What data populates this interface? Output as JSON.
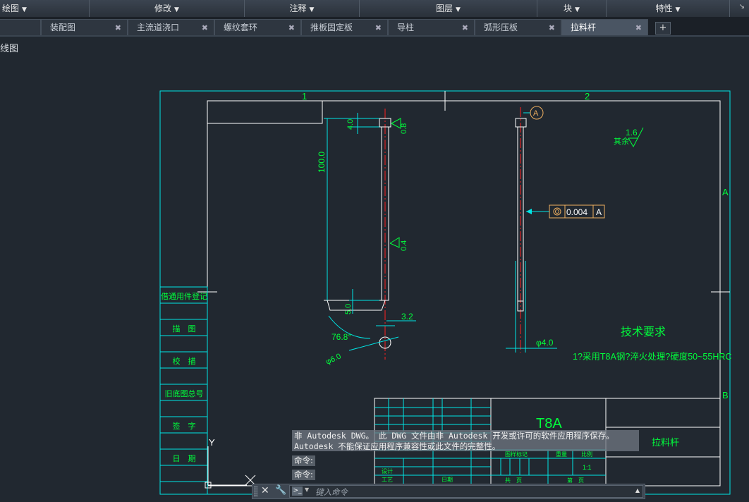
{
  "ribbon": {
    "panels": [
      {
        "label": "绘图"
      },
      {
        "label": "修改"
      },
      {
        "label": "注释"
      },
      {
        "label": "图层"
      },
      {
        "label": "块"
      },
      {
        "label": "特性"
      }
    ],
    "corner_icon": "panel-expand-icon"
  },
  "tabs": [
    {
      "label": "装配图"
    },
    {
      "label": "主流道浇口"
    },
    {
      "label": "螺纹套环"
    },
    {
      "label": "推板固定板"
    },
    {
      "label": "导柱"
    },
    {
      "label": "弧形压板"
    },
    {
      "label": "拉料杆",
      "active": true
    }
  ],
  "add_tab_symbol": "+",
  "view_label": "线图",
  "drawing": {
    "zone_top": [
      "1",
      "2"
    ],
    "zone_side": [
      "A",
      "B"
    ],
    "left_strip": [
      "借通用件登记",
      "描　图",
      "校　描",
      "旧底图总号",
      "签　字",
      "日　期"
    ],
    "dims": {
      "d1": "4.0",
      "d2": "100.0",
      "d3": "5.0",
      "d4": "3.2",
      "d5": "76.8°",
      "d6": "φ6.0",
      "d7": "φ4.0"
    },
    "roughness": {
      "r1": "0.8",
      "r2": "0.4",
      "r3": "1.6",
      "rest_label": "其余"
    },
    "datum": "A",
    "tolerance": {
      "value": "0.004",
      "datum": "A"
    },
    "tech_title": "技术要求",
    "tech_text": "1?采用T8A钢?淬火处理?硬度50~55HRC",
    "title_block": {
      "material": "T8A",
      "part_name": "拉料杆",
      "scale": "1:1",
      "labels": {
        "stage": "图样标记",
        "weight": "重量",
        "ratio": "比例",
        "designer": "设计",
        "process": "工艺",
        "date": "日期",
        "sheet": "共　页",
        "page": "第　页"
      }
    },
    "ucs_y": "Y"
  },
  "command": {
    "message_line1": "非 Autodesk DWG。 此 DWG 文件由非 Autodesk 开发或许可的软件应用程序保存。",
    "message_line2": "Autodesk 不能保证应用程序兼容性或此文件的完整性。",
    "history": [
      "命令:",
      "命令:"
    ],
    "placeholder": "键入命令"
  },
  "colors": {
    "cyan": "#00e6e6",
    "green": "#00ff3c",
    "white": "#ffffff",
    "red": "#ff2020",
    "amber": "#f0b060",
    "bg": "#212830"
  }
}
